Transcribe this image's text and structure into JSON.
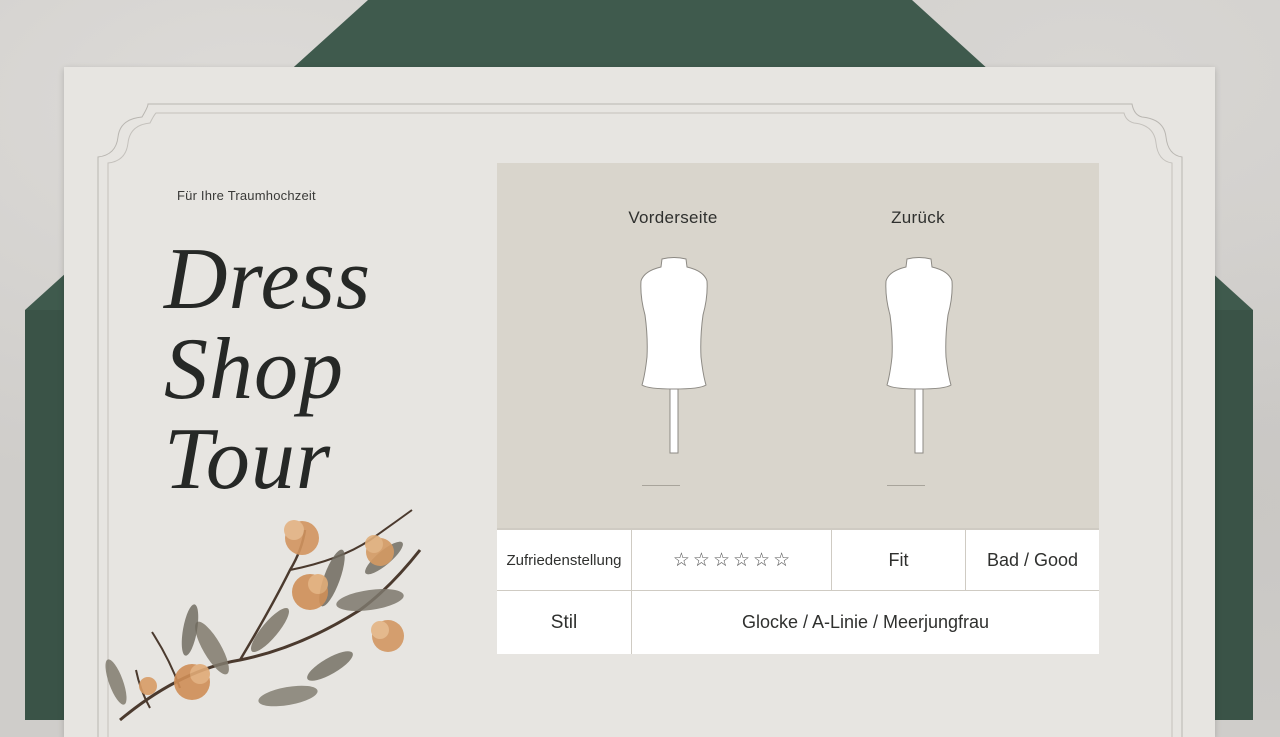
{
  "tagline": "Für Ihre Traumhochzeit",
  "title_lines": [
    "Dress",
    "Shop",
    "Tour"
  ],
  "panel": {
    "front_label": "Vorderseite",
    "back_label": "Zurück"
  },
  "table": {
    "satisfaction_label": "Zufriedenstellung",
    "rating_stars": 6,
    "star_glyph": "☆",
    "fit_label": "Fit",
    "fit_value": "Bad / Good",
    "style_label": "Stil",
    "style_value": "Glocke / A-Linie / Meerjungfrau"
  },
  "colors": {
    "envelope_green": "#3f5a4d",
    "card": "#e7e5e1",
    "panel": "#d9d5cc",
    "text": "#262826"
  }
}
